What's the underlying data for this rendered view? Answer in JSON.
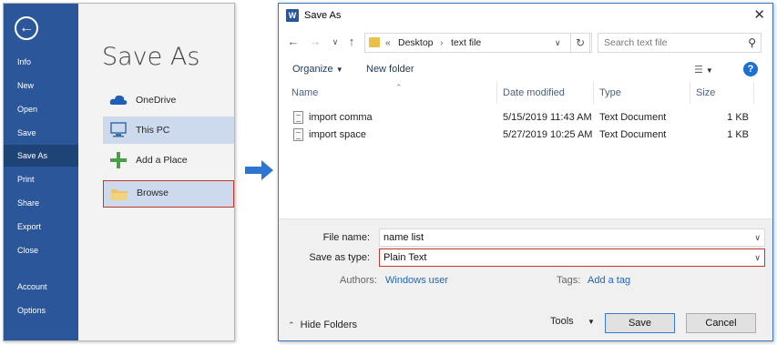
{
  "backstage": {
    "nav": [
      "Info",
      "New",
      "Open",
      "Save",
      "Save As",
      "Print",
      "Share",
      "Export",
      "Close"
    ],
    "nav_bottom": [
      "Account",
      "Options"
    ],
    "active": "Save As",
    "title": "Save As",
    "places": [
      "OneDrive",
      "This PC",
      "Add a Place",
      "Browse"
    ]
  },
  "dialog": {
    "title": "Save As",
    "breadcrumb": {
      "prefix": "«",
      "parts": [
        "Desktop",
        "text file"
      ]
    },
    "search_placeholder": "Search text file",
    "toolbar": {
      "organize": "Organize",
      "new_folder": "New folder"
    },
    "columns": [
      "Name",
      "Date modified",
      "Type",
      "Size"
    ],
    "files": [
      {
        "name": "import comma",
        "date": "5/15/2019 11:43 AM",
        "type": "Text Document",
        "size": "1 KB"
      },
      {
        "name": "import space",
        "date": "5/27/2019 10:25 AM",
        "type": "Text Document",
        "size": "1 KB"
      }
    ],
    "file_name_label": "File name:",
    "file_name_value": "name list",
    "save_type_label": "Save as type:",
    "save_type_value": "Plain Text",
    "authors_label": "Authors:",
    "authors_value": "Windows user",
    "tags_label": "Tags:",
    "tags_value": "Add a tag",
    "hide_folders": "Hide Folders",
    "tools": "Tools",
    "save": "Save",
    "cancel": "Cancel"
  },
  "colors": {
    "word_blue": "#2b579a",
    "highlight_red": "#c0392b",
    "arrow_blue": "#2e75d1"
  }
}
